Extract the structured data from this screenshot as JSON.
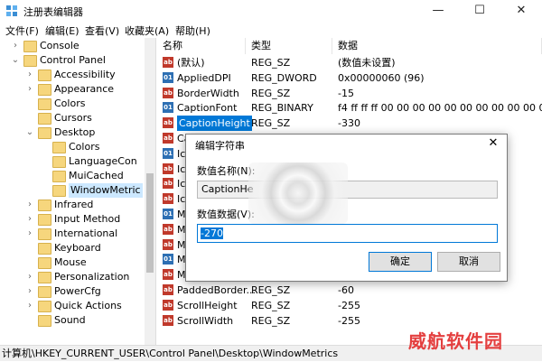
{
  "window": {
    "title": "注册表编辑器",
    "minimize": "—",
    "maximize": "☐",
    "close": "✕"
  },
  "menu": [
    "文件(F)",
    "编辑(E)",
    "查看(V)",
    "收藏夹(A)",
    "帮助(H)"
  ],
  "tree": [
    {
      "label": "Console",
      "indent": 1,
      "expander": "›"
    },
    {
      "label": "Control Panel",
      "indent": 1,
      "expander": "⌄"
    },
    {
      "label": "Accessibility",
      "indent": 2,
      "expander": "›"
    },
    {
      "label": "Appearance",
      "indent": 2,
      "expander": "›"
    },
    {
      "label": "Colors",
      "indent": 2,
      "expander": ""
    },
    {
      "label": "Cursors",
      "indent": 2,
      "expander": ""
    },
    {
      "label": "Desktop",
      "indent": 2,
      "expander": "⌄"
    },
    {
      "label": "Colors",
      "indent": 3,
      "expander": ""
    },
    {
      "label": "LanguageCon",
      "indent": 3,
      "expander": ""
    },
    {
      "label": "MuiCached",
      "indent": 3,
      "expander": ""
    },
    {
      "label": "WindowMetric",
      "indent": 3,
      "expander": "",
      "selected": true
    },
    {
      "label": "Infrared",
      "indent": 2,
      "expander": "›"
    },
    {
      "label": "Input Method",
      "indent": 2,
      "expander": "›"
    },
    {
      "label": "International",
      "indent": 2,
      "expander": "›"
    },
    {
      "label": "Keyboard",
      "indent": 2,
      "expander": ""
    },
    {
      "label": "Mouse",
      "indent": 2,
      "expander": ""
    },
    {
      "label": "Personalization",
      "indent": 2,
      "expander": "›"
    },
    {
      "label": "PowerCfg",
      "indent": 2,
      "expander": "›"
    },
    {
      "label": "Quick Actions",
      "indent": 2,
      "expander": "›"
    },
    {
      "label": "Sound",
      "indent": 2,
      "expander": ""
    }
  ],
  "columns": {
    "name": "名称",
    "type": "类型",
    "data": "数据"
  },
  "values": [
    {
      "name": "(默认)",
      "type": "REG_SZ",
      "data": "(数值未设置)",
      "kind": "sz"
    },
    {
      "name": "AppliedDPI",
      "type": "REG_DWORD",
      "data": "0x00000060 (96)",
      "kind": "bin"
    },
    {
      "name": "BorderWidth",
      "type": "REG_SZ",
      "data": "-15",
      "kind": "sz"
    },
    {
      "name": "CaptionFont",
      "type": "REG_BINARY",
      "data": "f4 ff ff ff 00 00 00 00 00 00 00 00 00 00 00",
      "kind": "bin"
    },
    {
      "name": "CaptionHeight",
      "type": "REG_SZ",
      "data": "-330",
      "kind": "sz",
      "selected": true
    },
    {
      "name": "Ca",
      "type": "",
      "data": "",
      "kind": "sz"
    },
    {
      "name": "Ico",
      "type": "",
      "data": "00",
      "kind": "bin"
    },
    {
      "name": "Ico",
      "type": "",
      "data": "",
      "kind": "sz"
    },
    {
      "name": "Ico",
      "type": "",
      "data": "",
      "kind": "sz"
    },
    {
      "name": "Ico",
      "type": "",
      "data": "",
      "kind": "sz"
    },
    {
      "name": "Me",
      "type": "",
      "data": "00",
      "kind": "bin"
    },
    {
      "name": "Me",
      "type": "",
      "data": "",
      "kind": "sz"
    },
    {
      "name": "Me",
      "type": "",
      "data": "",
      "kind": "sz"
    },
    {
      "name": "Me",
      "type": "",
      "data": "00",
      "kind": "bin"
    },
    {
      "name": "Mi",
      "type": "",
      "data": "",
      "kind": "sz"
    },
    {
      "name": "PaddedBorder...",
      "type": "REG_SZ",
      "data": "-60",
      "kind": "sz"
    },
    {
      "name": "ScrollHeight",
      "type": "REG_SZ",
      "data": "-255",
      "kind": "sz"
    },
    {
      "name": "ScrollWidth",
      "type": "REG_SZ",
      "data": "-255",
      "kind": "sz"
    }
  ],
  "dialog": {
    "title": "编辑字符串",
    "close": "✕",
    "name_label": "数值名称(N):",
    "name_value": "CaptionHe",
    "data_label": "数值数据(V):",
    "data_value": "-270",
    "ok": "确定",
    "cancel": "取消"
  },
  "status": "计算机\\HKEY_CURRENT_USER\\Control Panel\\Desktop\\WindowMetrics",
  "watermark": "威航软件园"
}
